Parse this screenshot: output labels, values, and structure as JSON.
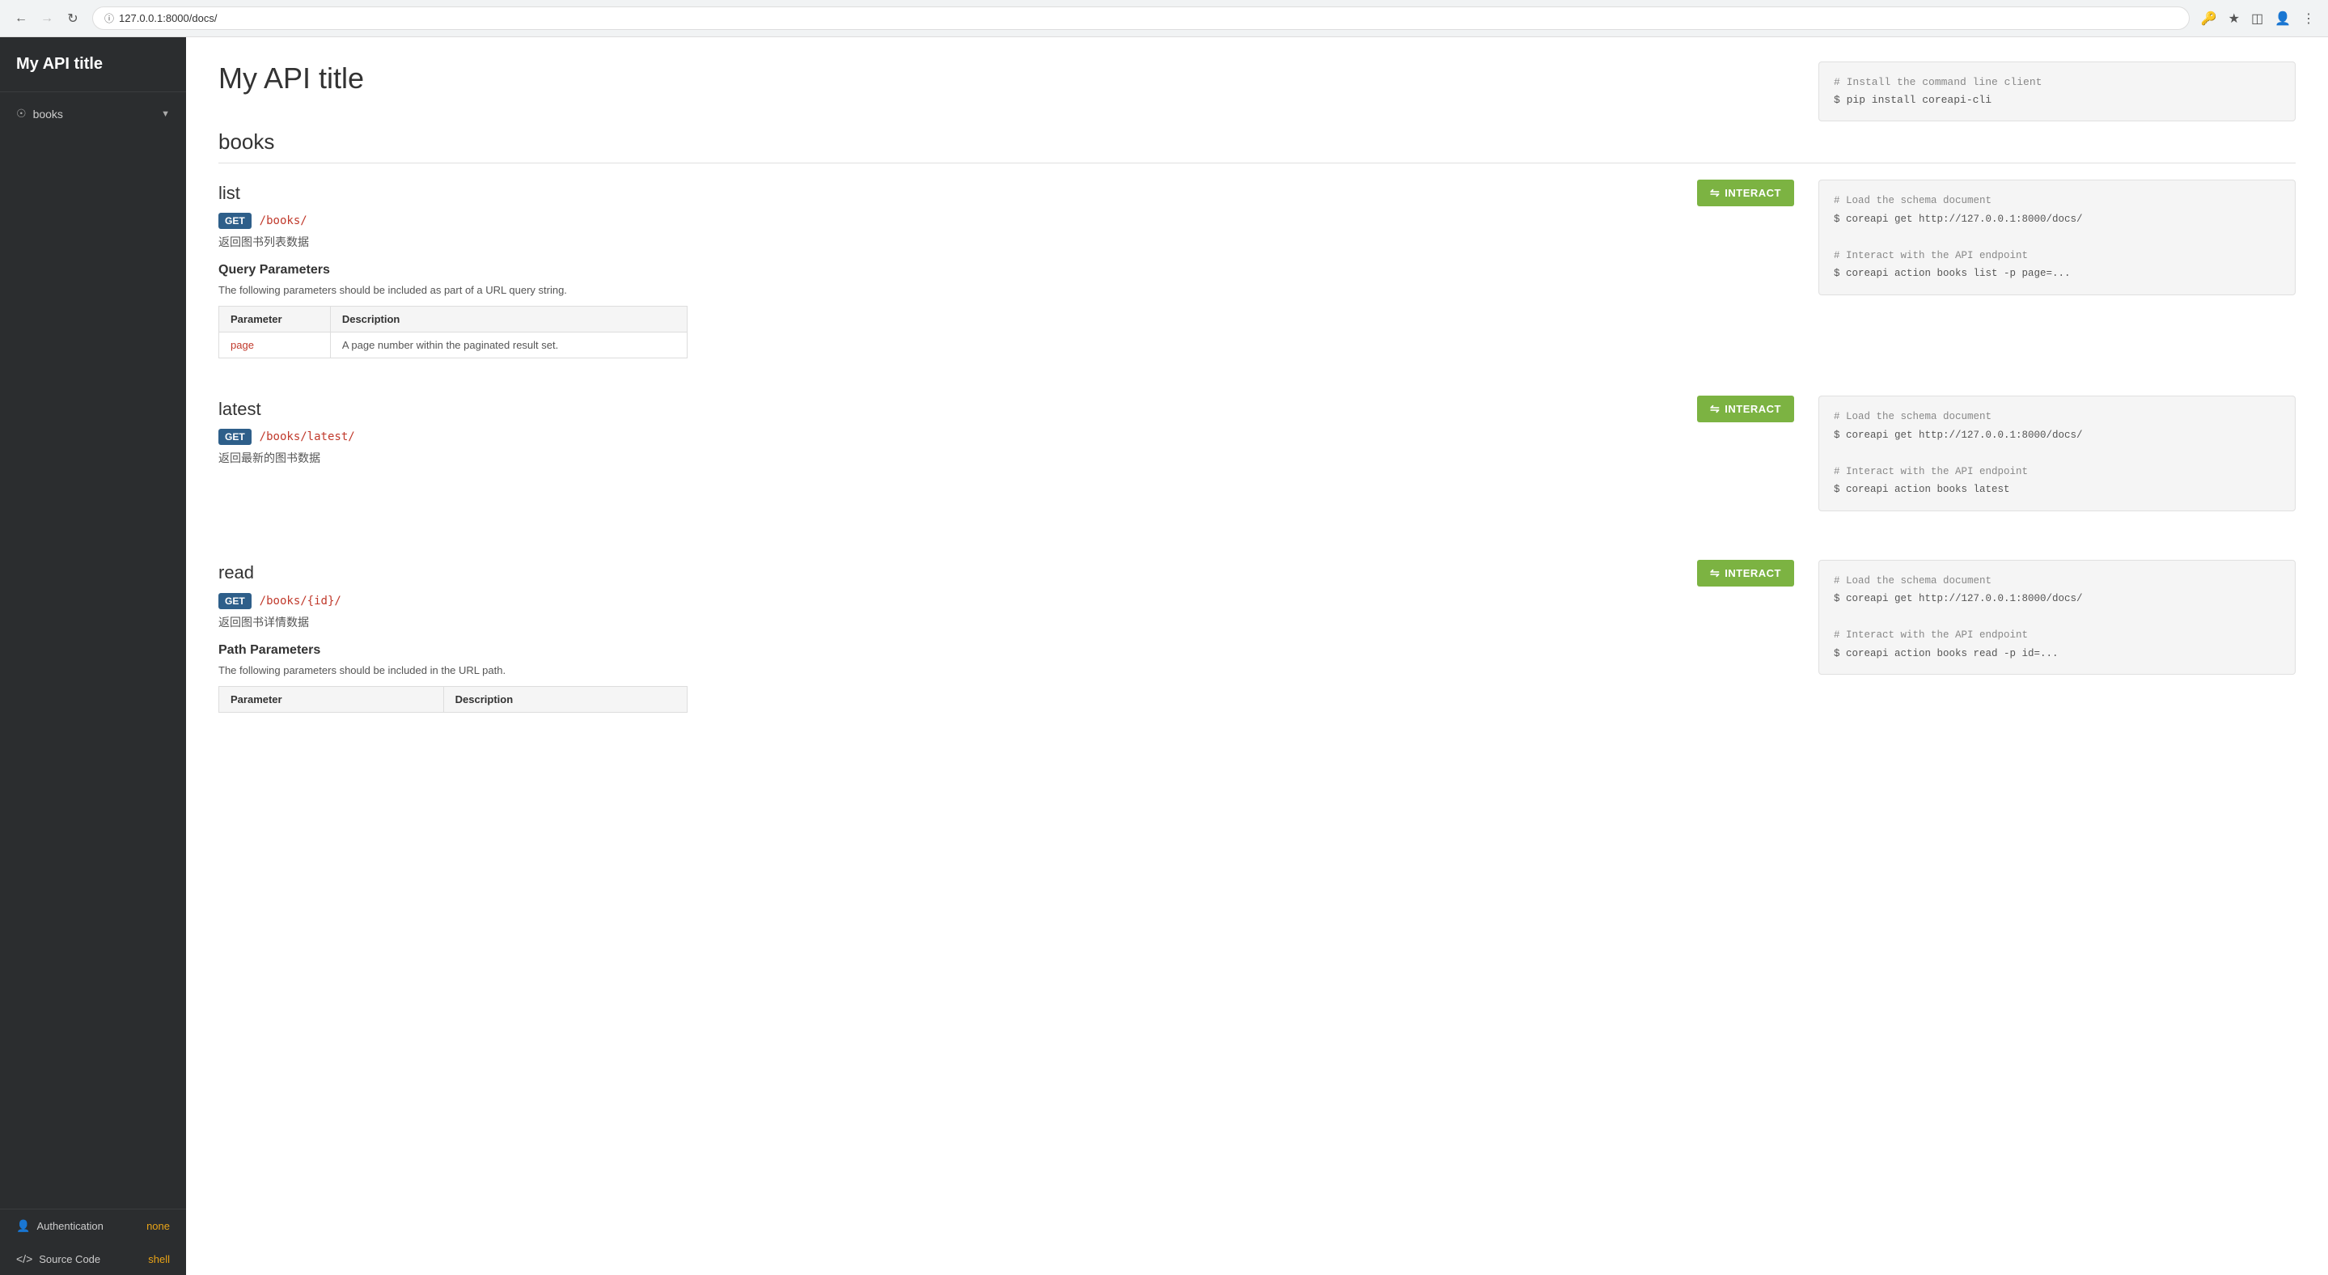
{
  "browser": {
    "url": "127.0.0.1:8000/docs/",
    "back_disabled": false,
    "forward_disabled": true
  },
  "sidebar": {
    "title": "My API title",
    "nav_items": [
      {
        "id": "books",
        "label": "books",
        "icon": "⊙",
        "has_chevron": true
      }
    ],
    "footer_items": [
      {
        "id": "authentication",
        "icon": "👤",
        "label": "Authentication",
        "badge": "none",
        "icon_type": "person"
      },
      {
        "id": "source-code",
        "icon": "</>",
        "label": "Source Code",
        "badge": "shell",
        "icon_type": "code"
      }
    ]
  },
  "main": {
    "page_title": "My API title",
    "top_code": "# Install the command line client\n$ pip install coreapi-cli",
    "sections": [
      {
        "id": "books",
        "title": "books",
        "endpoints": [
          {
            "id": "list",
            "name": "list",
            "method": "GET",
            "path": "/books/",
            "description": "返回图书列表数据",
            "interact_label": "⇌ INTERACT",
            "code": "# Load the schema document\n$ coreapi get http://127.0.0.1:8000/docs/\n\n# Interact with the API endpoint\n$ coreapi action books list -p page=...",
            "has_query_params": true,
            "query_section_title": "Query Parameters",
            "query_section_desc": "The following parameters should be included as part of a URL query string.",
            "params_columns": [
              "Parameter",
              "Description"
            ],
            "params": [
              {
                "name": "page",
                "description": "A page number within the paginated result set."
              }
            ]
          },
          {
            "id": "latest",
            "name": "latest",
            "method": "GET",
            "path": "/books/latest/",
            "description": "返回最新的图书数据",
            "interact_label": "⇌ INTERACT",
            "code": "# Load the schema document\n$ coreapi get http://127.0.0.1:8000/docs/\n\n# Interact with the API endpoint\n$ coreapi action books latest",
            "has_query_params": false
          },
          {
            "id": "read",
            "name": "read",
            "method": "GET",
            "path": "/books/{id}/",
            "description": "返回图书详情数据",
            "interact_label": "⇌ INTERACT",
            "code": "# Load the schema document\n$ coreapi get http://127.0.0.1:8000/docs/\n\n# Interact with the API endpoint\n$ coreapi action books read -p id=...",
            "has_path_params": true,
            "path_section_title": "Path Parameters",
            "path_section_desc": "The following parameters should be included in the URL path.",
            "params_columns": [
              "Parameter",
              "Description"
            ],
            "params": []
          }
        ]
      }
    ]
  }
}
